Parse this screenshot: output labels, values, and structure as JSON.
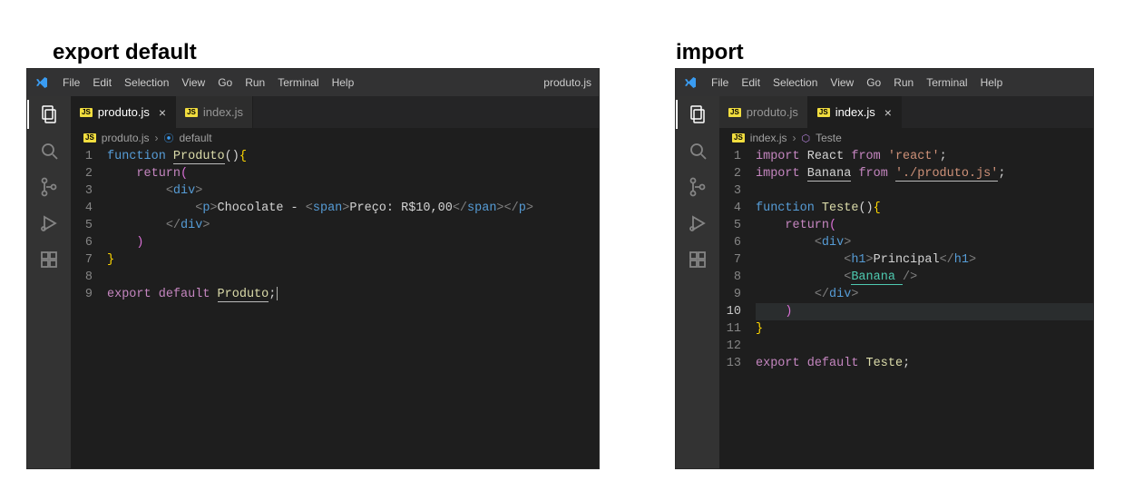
{
  "headings": {
    "left": "export default",
    "right": "import"
  },
  "left": {
    "titlebar": {
      "menu": [
        "File",
        "Edit",
        "Selection",
        "View",
        "Go",
        "Run",
        "Terminal",
        "Help"
      ],
      "activeFile": "produto.js"
    },
    "tabs": [
      {
        "badge": "JS",
        "label": "produto.js",
        "active": true,
        "close": "×"
      },
      {
        "badge": "JS",
        "label": "index.js",
        "active": false,
        "close": ""
      }
    ],
    "breadcrumb": {
      "fileBadge": "JS",
      "file": "produto.js",
      "sep": "›",
      "symbolIcon": "⦿",
      "symbol": "default"
    },
    "code": {
      "lines": [
        [
          {
            "c": "tok-kw",
            "t": "function"
          },
          {
            "c": "tok-txt",
            "t": " "
          },
          {
            "c": "tok-fn underline",
            "t": "Produto"
          },
          {
            "c": "tok-paren",
            "t": "()"
          },
          {
            "c": "tok-braceY",
            "t": "{"
          }
        ],
        [
          {
            "c": "tok-txt",
            "t": "    "
          },
          {
            "c": "tok-kw2",
            "t": "return"
          },
          {
            "c": "tok-parenP",
            "t": "("
          }
        ],
        [
          {
            "c": "tok-txt",
            "t": "        "
          },
          {
            "c": "tok-brkt",
            "t": "<"
          },
          {
            "c": "tok-tag",
            "t": "div"
          },
          {
            "c": "tok-brkt",
            "t": ">"
          }
        ],
        [
          {
            "c": "tok-txt",
            "t": "            "
          },
          {
            "c": "tok-brkt",
            "t": "<"
          },
          {
            "c": "tok-tag",
            "t": "p"
          },
          {
            "c": "tok-brkt",
            "t": ">"
          },
          {
            "c": "tok-txt",
            "t": "Chocolate - "
          },
          {
            "c": "tok-brkt",
            "t": "<"
          },
          {
            "c": "tok-tag",
            "t": "span"
          },
          {
            "c": "tok-brkt",
            "t": ">"
          },
          {
            "c": "tok-txt",
            "t": "Preço: R$10,00"
          },
          {
            "c": "tok-brkt",
            "t": "</"
          },
          {
            "c": "tok-tag",
            "t": "span"
          },
          {
            "c": "tok-brkt",
            "t": ">"
          },
          {
            "c": "tok-brkt",
            "t": "</"
          },
          {
            "c": "tok-tag",
            "t": "p"
          },
          {
            "c": "tok-brkt",
            "t": ">"
          }
        ],
        [
          {
            "c": "tok-txt",
            "t": "        "
          },
          {
            "c": "tok-brkt",
            "t": "</"
          },
          {
            "c": "tok-tag",
            "t": "div"
          },
          {
            "c": "tok-brkt",
            "t": ">"
          }
        ],
        [
          {
            "c": "tok-txt",
            "t": "    "
          },
          {
            "c": "tok-parenP",
            "t": ")"
          }
        ],
        [
          {
            "c": "tok-braceY",
            "t": "}"
          }
        ],
        [],
        [
          {
            "c": "tok-kw2",
            "t": "export"
          },
          {
            "c": "tok-txt",
            "t": " "
          },
          {
            "c": "tok-kw2",
            "t": "default"
          },
          {
            "c": "tok-txt",
            "t": " "
          },
          {
            "c": "tok-fn underline",
            "t": "Produto"
          },
          {
            "c": "tok-txt",
            "t": ";"
          }
        ]
      ],
      "cursorLine": 9
    }
  },
  "right": {
    "titlebar": {
      "menu": [
        "File",
        "Edit",
        "Selection",
        "View",
        "Go",
        "Run",
        "Terminal",
        "Help"
      ],
      "activeFile": ""
    },
    "tabs": [
      {
        "badge": "JS",
        "label": "produto.js",
        "active": false,
        "close": ""
      },
      {
        "badge": "JS",
        "label": "index.js",
        "active": true,
        "close": "×"
      }
    ],
    "breadcrumb": {
      "fileBadge": "JS",
      "file": "index.js",
      "sep": "›",
      "symbolIcon": "⬡",
      "symbol": "Teste"
    },
    "code": {
      "lines": [
        [
          {
            "c": "tok-kw2",
            "t": "import"
          },
          {
            "c": "tok-txt",
            "t": " "
          },
          {
            "c": "tok-txt",
            "t": "React"
          },
          {
            "c": "tok-txt",
            "t": " "
          },
          {
            "c": "tok-kw2",
            "t": "from"
          },
          {
            "c": "tok-txt",
            "t": " "
          },
          {
            "c": "tok-str",
            "t": "'react'"
          },
          {
            "c": "tok-txt",
            "t": ";"
          }
        ],
        [
          {
            "c": "tok-kw2",
            "t": "import"
          },
          {
            "c": "tok-txt",
            "t": " "
          },
          {
            "c": "tok-txt underline",
            "t": "Banana"
          },
          {
            "c": "tok-txt",
            "t": " "
          },
          {
            "c": "tok-kw2",
            "t": "from"
          },
          {
            "c": "tok-txt",
            "t": " "
          },
          {
            "c": "tok-str underline",
            "t": "'./produto.js'"
          },
          {
            "c": "tok-txt",
            "t": ";"
          }
        ],
        [],
        [
          {
            "c": "tok-kw",
            "t": "function"
          },
          {
            "c": "tok-txt",
            "t": " "
          },
          {
            "c": "tok-fn",
            "t": "Teste"
          },
          {
            "c": "tok-paren",
            "t": "()"
          },
          {
            "c": "tok-braceY",
            "t": "{"
          }
        ],
        [
          {
            "c": "tok-txt",
            "t": "    "
          },
          {
            "c": "tok-kw2",
            "t": "return"
          },
          {
            "c": "tok-parenP",
            "t": "("
          }
        ],
        [
          {
            "c": "tok-txt",
            "t": "        "
          },
          {
            "c": "tok-brkt",
            "t": "<"
          },
          {
            "c": "tok-tag",
            "t": "div"
          },
          {
            "c": "tok-brkt",
            "t": ">"
          }
        ],
        [
          {
            "c": "tok-txt",
            "t": "            "
          },
          {
            "c": "tok-brkt",
            "t": "<"
          },
          {
            "c": "tok-tag",
            "t": "h1"
          },
          {
            "c": "tok-brkt",
            "t": ">"
          },
          {
            "c": "tok-txt",
            "t": "Principal"
          },
          {
            "c": "tok-brkt",
            "t": "</"
          },
          {
            "c": "tok-tag",
            "t": "h1"
          },
          {
            "c": "tok-brkt",
            "t": ">"
          }
        ],
        [
          {
            "c": "tok-txt",
            "t": "            "
          },
          {
            "c": "tok-brkt",
            "t": "<"
          },
          {
            "c": "tok-comp underlineG",
            "t": "Banana "
          },
          {
            "c": "tok-brkt",
            "t": "/>"
          }
        ],
        [
          {
            "c": "tok-txt",
            "t": "        "
          },
          {
            "c": "tok-brkt",
            "t": "</"
          },
          {
            "c": "tok-tag",
            "t": "div"
          },
          {
            "c": "tok-brkt",
            "t": ">"
          }
        ],
        [
          {
            "c": "tok-txt",
            "t": "    "
          },
          {
            "c": "tok-parenP",
            "t": ")"
          }
        ],
        [
          {
            "c": "tok-braceY",
            "t": "}"
          }
        ],
        [],
        [
          {
            "c": "tok-kw2",
            "t": "export"
          },
          {
            "c": "tok-txt",
            "t": " "
          },
          {
            "c": "tok-kw2",
            "t": "default"
          },
          {
            "c": "tok-txt",
            "t": " "
          },
          {
            "c": "tok-fn",
            "t": "Teste"
          },
          {
            "c": "tok-txt",
            "t": ";"
          }
        ]
      ],
      "currentLine": 10
    }
  }
}
